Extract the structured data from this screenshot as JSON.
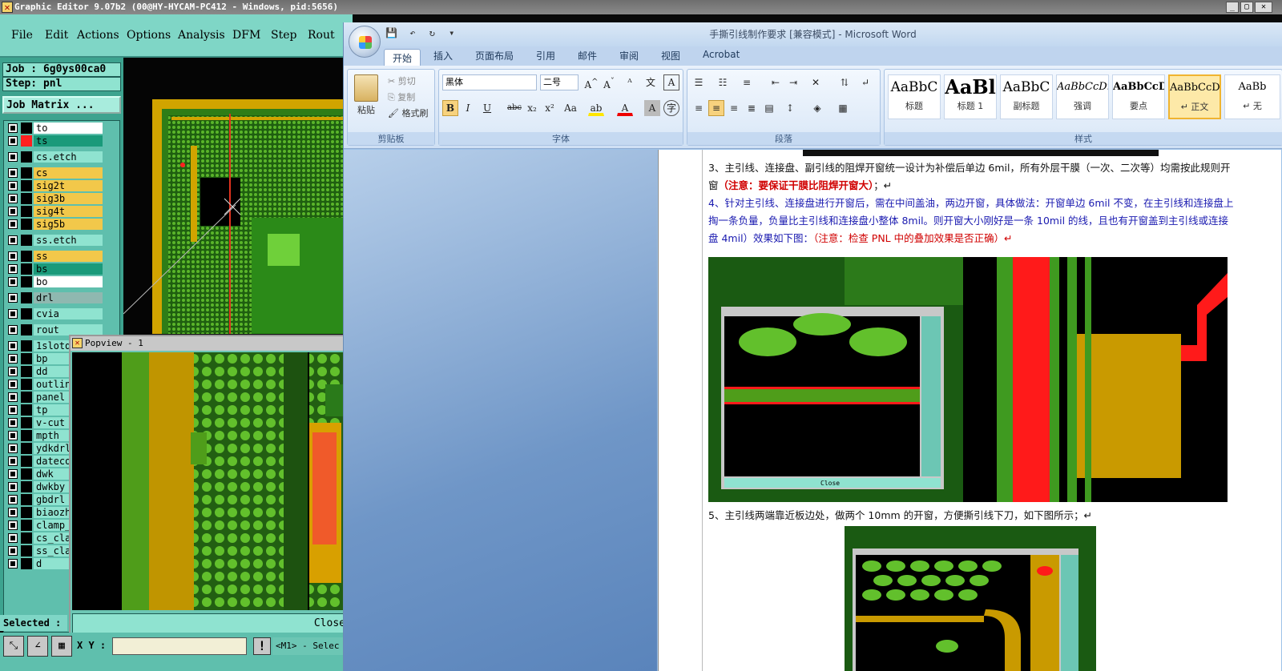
{
  "genesis": {
    "title": "Graphic Editor 9.07b2 (00@HY-HYCAM-PC412 - Windows, pid:5656)",
    "menu": [
      "File",
      "Edit",
      "Actions",
      "Options",
      "Analysis",
      "DFM",
      "Step",
      "Rout"
    ],
    "job": "Job : 6g0ys00ca0",
    "step": "Step: pnl",
    "job_matrix": "Job Matrix ...",
    "layers": [
      {
        "name": "to",
        "color": "#ffffff",
        "sw": "#000000"
      },
      {
        "name": "ts",
        "color": "#1a9a7a",
        "sw": "#ff2020"
      },
      {
        "name": "cs.etch",
        "color": "#8fe3d0",
        "sw": "#000000"
      },
      {
        "name": "cs",
        "color": "#f2c84a",
        "sw": "#000000"
      },
      {
        "name": "sig2t",
        "color": "#f2c84a",
        "sw": "#000000"
      },
      {
        "name": "sig3b",
        "color": "#f2c84a",
        "sw": "#000000"
      },
      {
        "name": "sig4t",
        "color": "#f2c84a",
        "sw": "#000000"
      },
      {
        "name": "sig5b",
        "color": "#f2c84a",
        "sw": "#000000"
      },
      {
        "name": "ss.etch",
        "color": "#8fe3d0",
        "sw": "#000000"
      },
      {
        "name": "ss",
        "color": "#f2c84a",
        "sw": "#000000"
      },
      {
        "name": "bs",
        "color": "#1a9a7a",
        "sw": "#000000"
      },
      {
        "name": "bo",
        "color": "#ffffff",
        "sw": "#000000"
      },
      {
        "name": "drl",
        "color": "#8fb8b0",
        "sw": "#000000"
      },
      {
        "name": "cvia",
        "color": "#8fe3d0",
        "sw": "#000000"
      },
      {
        "name": "rout",
        "color": "#8fe3d0",
        "sw": "#000000"
      },
      {
        "name": "1slotd",
        "color": "#8fe3d0",
        "sw": "#000000"
      },
      {
        "name": "bp",
        "color": "#8fe3d0",
        "sw": "#000000"
      },
      {
        "name": "dd",
        "color": "#8fe3d0",
        "sw": "#000000"
      },
      {
        "name": "outlin",
        "color": "#8fe3d0",
        "sw": "#000000"
      },
      {
        "name": "panel",
        "color": "#8fe3d0",
        "sw": "#000000"
      },
      {
        "name": "tp",
        "color": "#8fe3d0",
        "sw": "#000000"
      },
      {
        "name": "v-cut",
        "color": "#8fe3d0",
        "sw": "#000000"
      },
      {
        "name": "mpth",
        "color": "#8fe3d0",
        "sw": "#000000"
      },
      {
        "name": "ydkdrl",
        "color": "#8fe3d0",
        "sw": "#000000"
      },
      {
        "name": "dateco",
        "color": "#8fe3d0",
        "sw": "#000000"
      },
      {
        "name": "dwk",
        "color": "#8fe3d0",
        "sw": "#000000"
      },
      {
        "name": "dwkby",
        "color": "#8fe3d0",
        "sw": "#000000"
      },
      {
        "name": "gbdrl",
        "color": "#8fe3d0",
        "sw": "#000000"
      },
      {
        "name": "biaozh",
        "color": "#8fe3d0",
        "sw": "#000000"
      },
      {
        "name": "clamp_",
        "color": "#8fe3d0",
        "sw": "#000000"
      },
      {
        "name": "cs_cla",
        "color": "#8fe3d0",
        "sw": "#000000"
      },
      {
        "name": "ss_cla",
        "color": "#8fe3d0",
        "sw": "#000000"
      },
      {
        "name": "d",
        "color": "#8fe3d0",
        "sw": "#000000"
      }
    ],
    "selected": "Selected :",
    "xy_label": "X Y :",
    "m1": "<M1> - Selec",
    "popview_title": "Popview - 1",
    "popview_close": "Close"
  },
  "word": {
    "title": "手撕引线制作要求 [兼容模式] - Microsoft Word",
    "tabs": [
      "开始",
      "插入",
      "页面布局",
      "引用",
      "邮件",
      "审阅",
      "视图",
      "Acrobat"
    ],
    "clipboard": {
      "paste": "粘贴",
      "cut": "剪切",
      "copy": "复制",
      "format_painter": "格式刷",
      "label": "剪贴板"
    },
    "font": {
      "name": "黑体",
      "size": "二号",
      "label": "字体"
    },
    "paragraph_label": "段落",
    "styles_label": "样式",
    "styles": [
      {
        "preview": "AaBbC",
        "name": "标题"
      },
      {
        "preview": "AaBl",
        "name": "标题 1"
      },
      {
        "preview": "AaBbC",
        "name": "副标题"
      },
      {
        "preview": "AaBbCcDı",
        "name": "强调"
      },
      {
        "preview": "AaBbCcD",
        "name": "要点"
      },
      {
        "preview": "AaBbCcDı",
        "name": "↵ 正文"
      },
      {
        "preview": "AaBb",
        "name": "↵ 无"
      }
    ],
    "p3": "3、主引线、连接盘、副引线的阻焊开窗统一设计为补偿后单边 6mil，所有外层干膜（一次、二次等）均需按此规则开窗",
    "p3_red": "（注意：要保证干膜比阻焊开窗大）",
    "p3_end": "；↵",
    "p4": "4、针对主引线、连接盘进行开窗后，需在中间盖油，两边开窗，具体做法：开窗单边 6mil 不变，在主引线和连接盘上掏一条负量，负量比主引线和连接盘小整体 8mil。则开窗大小刚好是一条 10mil 的线，且也有开窗盖到主引线或连接盘 4mil）效果如下图：",
    "p4_red": "（注意：检查 PNL 中的叠加效果是否正确）↵",
    "p5": "5、主引线两端靠近板边处，做两个 10mm 的开窗，方便撕引线下刀，如下图所示；↵",
    "img_popview_close": "Close"
  }
}
